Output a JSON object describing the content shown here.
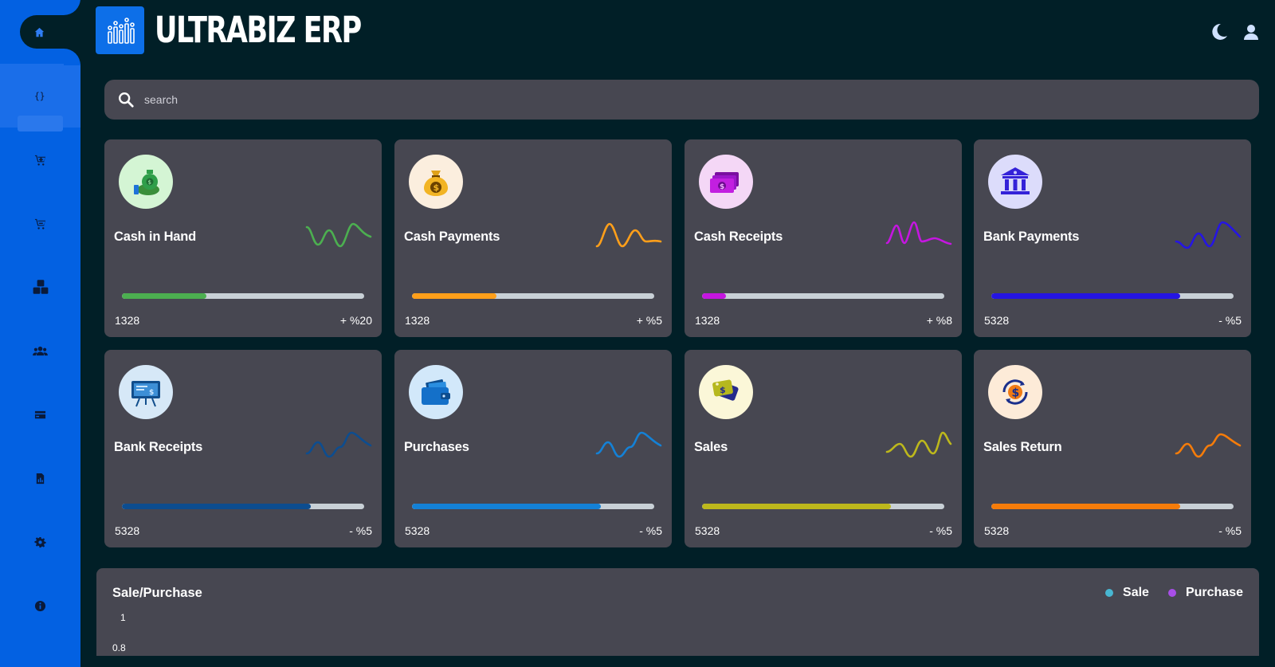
{
  "header": {
    "brand": "ULTRABIZ ERP"
  },
  "search": {
    "placeholder": "search"
  },
  "sidebar": {
    "items": [
      {
        "name": "home-icon"
      },
      {
        "name": "code-icon"
      },
      {
        "name": "cart-icon"
      },
      {
        "name": "cart-icon"
      },
      {
        "name": "boxes-icon"
      },
      {
        "name": "users-icon"
      },
      {
        "name": "credit-card-icon"
      },
      {
        "name": "report-icon"
      },
      {
        "name": "gear-icon"
      },
      {
        "name": "info-icon"
      }
    ]
  },
  "cards": [
    {
      "title": "Cash in Hand",
      "value": "1328",
      "change": "+ %20",
      "color": "#4caf50",
      "progress": 0.35,
      "icon_bg": "#d4f5d4",
      "icon": "money-bag-hand-icon"
    },
    {
      "title": "Cash Payments",
      "value": "1328",
      "change": "+ %5",
      "color": "#ff9f1a",
      "progress": 0.35,
      "icon_bg": "#fbeede",
      "icon": "coin-bag-icon"
    },
    {
      "title": "Cash Receipts",
      "value": "1328",
      "change": "+ %8",
      "color": "#c516e0",
      "progress": 0.1,
      "icon_bg": "#f4d7f6",
      "icon": "banknotes-icon"
    },
    {
      "title": "Bank Payments",
      "value": "5328",
      "change": "- %5",
      "color": "#2515e3",
      "progress": 0.78,
      "icon_bg": "#dcdcfb",
      "icon": "bank-icon"
    },
    {
      "title": "Bank Receipts",
      "value": "5328",
      "change": "- %5",
      "color": "#0d4d8f",
      "progress": 0.78,
      "icon_bg": "#d6e8f7",
      "icon": "presentation-board-icon"
    },
    {
      "title": "Purchases",
      "value": "5328",
      "change": "- %5",
      "color": "#1481d6",
      "progress": 0.78,
      "icon_bg": "#d2e8fa",
      "icon": "wallet-icon"
    },
    {
      "title": "Sales",
      "value": "5328",
      "change": "- %5",
      "color": "#bdb81c",
      "progress": 0.78,
      "icon_bg": "#fbf7d8",
      "icon": "price-tags-icon"
    },
    {
      "title": "Sales Return",
      "value": "5328",
      "change": "- %5",
      "color": "#f57c0a",
      "progress": 0.78,
      "icon_bg": "#fdebd8",
      "icon": "dollar-return-icon"
    }
  ],
  "chart_data": {
    "type": "line",
    "title": "Sale/Purchase",
    "series": [
      {
        "name": "Sale",
        "color": "#48b7d2",
        "values": []
      },
      {
        "name": "Purchase",
        "color": "#a84ee8",
        "values": []
      }
    ],
    "y_ticks": [
      "1",
      "0.8"
    ],
    "legend": "top-right"
  }
}
